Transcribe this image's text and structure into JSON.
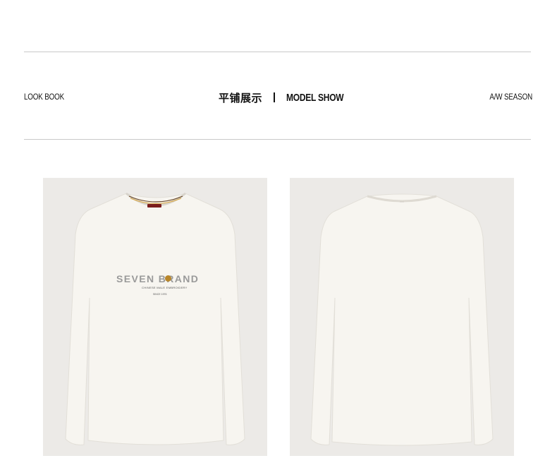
{
  "header": {
    "left_label": "LOOK BOOK",
    "title_cn": "平铺展示",
    "title_en": "MODEL SHOW",
    "right_label": "A/W SEASON"
  },
  "products": {
    "front": {
      "print_brand": "SEVEN BRAND",
      "print_sub": "CHINESE MALE EMBROIDERY",
      "print_since": "SINCE 1976"
    }
  },
  "colors": {
    "rule": "#c9c9c9",
    "photo_bg": "#eceae7",
    "shirt": "#f7f5f0"
  }
}
